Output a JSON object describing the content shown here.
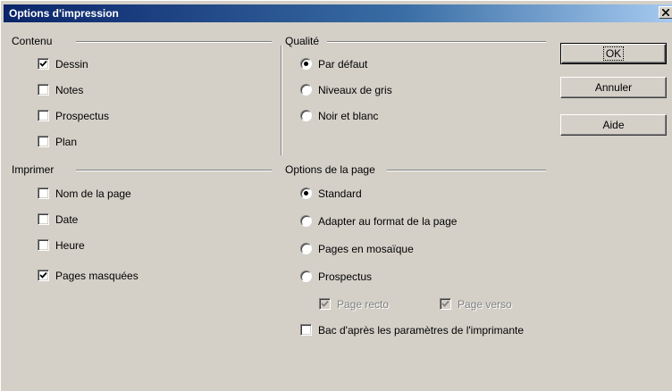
{
  "window": {
    "title": "Options d'impression",
    "close_glyph": "X"
  },
  "contenu": {
    "title": "Contenu",
    "items": [
      {
        "label": "Dessin",
        "checked": true
      },
      {
        "label": "Notes",
        "checked": false
      },
      {
        "label": "Prospectus",
        "checked": false
      },
      {
        "label": "Plan",
        "checked": false
      }
    ]
  },
  "qualite": {
    "title": "Qualité",
    "items": [
      {
        "label": "Par défaut",
        "selected": true
      },
      {
        "label": "Niveaux de gris",
        "selected": false
      },
      {
        "label": "Noir et blanc",
        "selected": false
      }
    ]
  },
  "imprimer": {
    "title": "Imprimer",
    "items": [
      {
        "label": "Nom de la page",
        "checked": false
      },
      {
        "label": "Date",
        "checked": false
      },
      {
        "label": "Heure",
        "checked": false
      },
      {
        "label": "Pages masquées",
        "checked": true
      }
    ]
  },
  "options_page": {
    "title": "Options de la page",
    "items": [
      {
        "label": "Standard",
        "selected": true
      },
      {
        "label": "Adapter au format de la page",
        "selected": false
      },
      {
        "label": "Pages en mosaïque",
        "selected": false
      },
      {
        "label": "Prospectus",
        "selected": false
      }
    ],
    "page_recto": {
      "label": "Page recto",
      "checked": true,
      "enabled": false
    },
    "page_verso": {
      "label": "Page verso",
      "checked": true,
      "enabled": false
    },
    "bac": {
      "label": "Bac d'après les paramètres de l'imprimante",
      "checked": false
    }
  },
  "buttons": {
    "ok": "OK",
    "cancel": "Annuler",
    "help": "Aide"
  }
}
